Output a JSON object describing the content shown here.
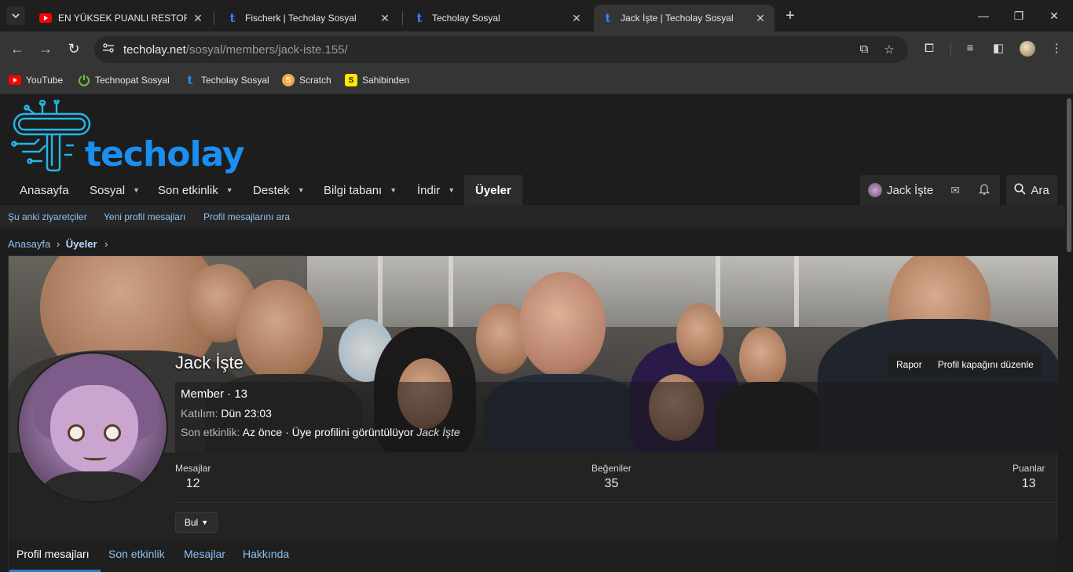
{
  "browser": {
    "tabs": [
      {
        "title": "EN YÜKSEK PUANLI RESTORAN",
        "favicon": "youtube-icon",
        "active": false
      },
      {
        "title": "Fischerk | Techolay Sosyal",
        "favicon": "techolay-icon",
        "active": false
      },
      {
        "title": "Techolay Sosyal",
        "favicon": "techolay-icon",
        "active": false
      },
      {
        "title": "Jack İşte | Techolay Sosyal",
        "favicon": "techolay-icon",
        "active": true
      }
    ],
    "url_host": "techolay.net",
    "url_path": "/sosyal/members/jack-iste.155/",
    "bookmarks": [
      {
        "label": "YouTube",
        "icon": "youtube-icon",
        "color": "#ff0000"
      },
      {
        "label": "Technopat Sosyal",
        "icon": "power-icon",
        "color": "#6bbf3a"
      },
      {
        "label": "Techolay Sosyal",
        "icon": "techolay-icon",
        "color": "#2b8cff"
      },
      {
        "label": "Scratch",
        "icon": "scratch-icon",
        "color": "#f9a64a"
      },
      {
        "label": "Sahibinden",
        "icon": "sahibinden-icon",
        "color": "#ffe800"
      }
    ]
  },
  "site": {
    "logo_text": "techolay",
    "nav": [
      {
        "label": "Anasayfa",
        "dropdown": false
      },
      {
        "label": "Sosyal",
        "dropdown": true
      },
      {
        "label": "Son etkinlik",
        "dropdown": true
      },
      {
        "label": "Destek",
        "dropdown": true
      },
      {
        "label": "Bilgi tabanı",
        "dropdown": true
      },
      {
        "label": "İndir",
        "dropdown": true
      },
      {
        "label": "Üyeler",
        "dropdown": false
      }
    ],
    "user_label": "Jack İşte",
    "search_label": "Ara",
    "subnav": [
      "Şu anki ziyaretçiler",
      "Yeni profil mesajları",
      "Profil mesajlarını ara"
    ],
    "breadcrumb": {
      "home": "Anasayfa",
      "current": "Üyeler"
    }
  },
  "profile": {
    "name": "Jack İşte",
    "title_line": "Member · 13",
    "joined_label": "Katılım:",
    "joined_value": "Dün 23:03",
    "last_activity_label": "Son etkinlik:",
    "last_activity_value": "Az önce · Üye profilini görüntülüyor",
    "last_activity_target": "Jack İşte",
    "actions": {
      "report": "Rapor",
      "edit_cover": "Profil kapağını düzenle"
    },
    "stats": [
      {
        "label": "Mesajlar",
        "value": "12"
      },
      {
        "label": "Beğeniler",
        "value": "35"
      },
      {
        "label": "Puanlar",
        "value": "13"
      }
    ],
    "find_button": "Bul",
    "tabs": [
      "Profil mesajları",
      "Son etkinlik",
      "Mesajlar",
      "Hakkında"
    ],
    "active_tab": "Profil mesajları"
  },
  "colors": {
    "accent": "#2f7ec5",
    "link": "#8fc0ef",
    "logo": "#1b8ef2"
  }
}
